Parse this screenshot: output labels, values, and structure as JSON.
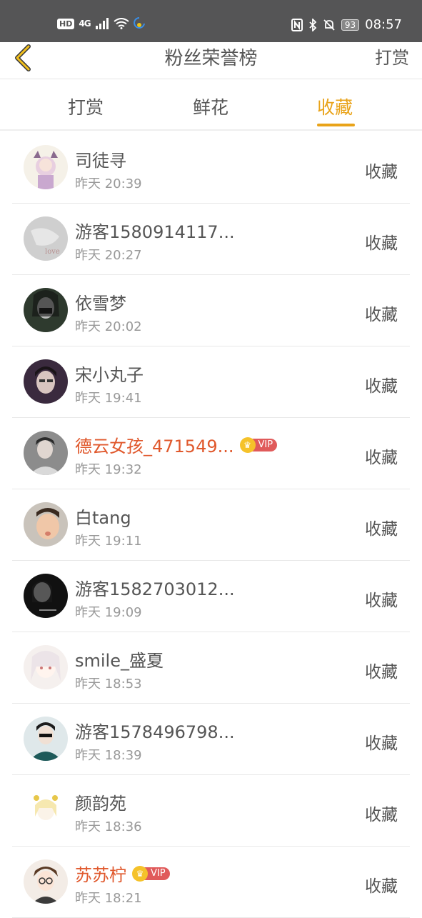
{
  "status_bar": {
    "hd": "HD",
    "network": "4G",
    "battery": "93",
    "time": "08:57"
  },
  "header": {
    "title": "粉丝荣誉榜",
    "action": "打赏"
  },
  "tabs": [
    {
      "label": "打赏"
    },
    {
      "label": "鲜花"
    },
    {
      "label": "收藏"
    }
  ],
  "active_tab": "收藏",
  "accent_color": "#e9a319",
  "vip_name_color": "#e0582c",
  "vip_label": "VIP",
  "list": [
    {
      "name": "司徒寻",
      "time": "昨天 20:39",
      "action": "收藏",
      "vip": false
    },
    {
      "name": "游客1580914117...",
      "time": "昨天 20:27",
      "action": "收藏",
      "vip": false
    },
    {
      "name": "依雪梦",
      "time": "昨天 20:02",
      "action": "收藏",
      "vip": false
    },
    {
      "name": "宋小丸子",
      "time": "昨天 19:41",
      "action": "收藏",
      "vip": false
    },
    {
      "name": "德云女孩_471549...",
      "time": "昨天 19:32",
      "action": "收藏",
      "vip": true
    },
    {
      "name": "白tang",
      "time": "昨天 19:11",
      "action": "收藏",
      "vip": false
    },
    {
      "name": "游客1582703012...",
      "time": "昨天 19:09",
      "action": "收藏",
      "vip": false
    },
    {
      "name": "smile_盛夏",
      "time": "昨天 18:53",
      "action": "收藏",
      "vip": false
    },
    {
      "name": "游客1578496798...",
      "time": "昨天 18:39",
      "action": "收藏",
      "vip": false
    },
    {
      "name": "颜韵苑",
      "time": "昨天 18:36",
      "action": "收藏",
      "vip": false
    },
    {
      "name": "苏苏柠",
      "time": "昨天 18:21",
      "action": "收藏",
      "vip": true
    }
  ]
}
